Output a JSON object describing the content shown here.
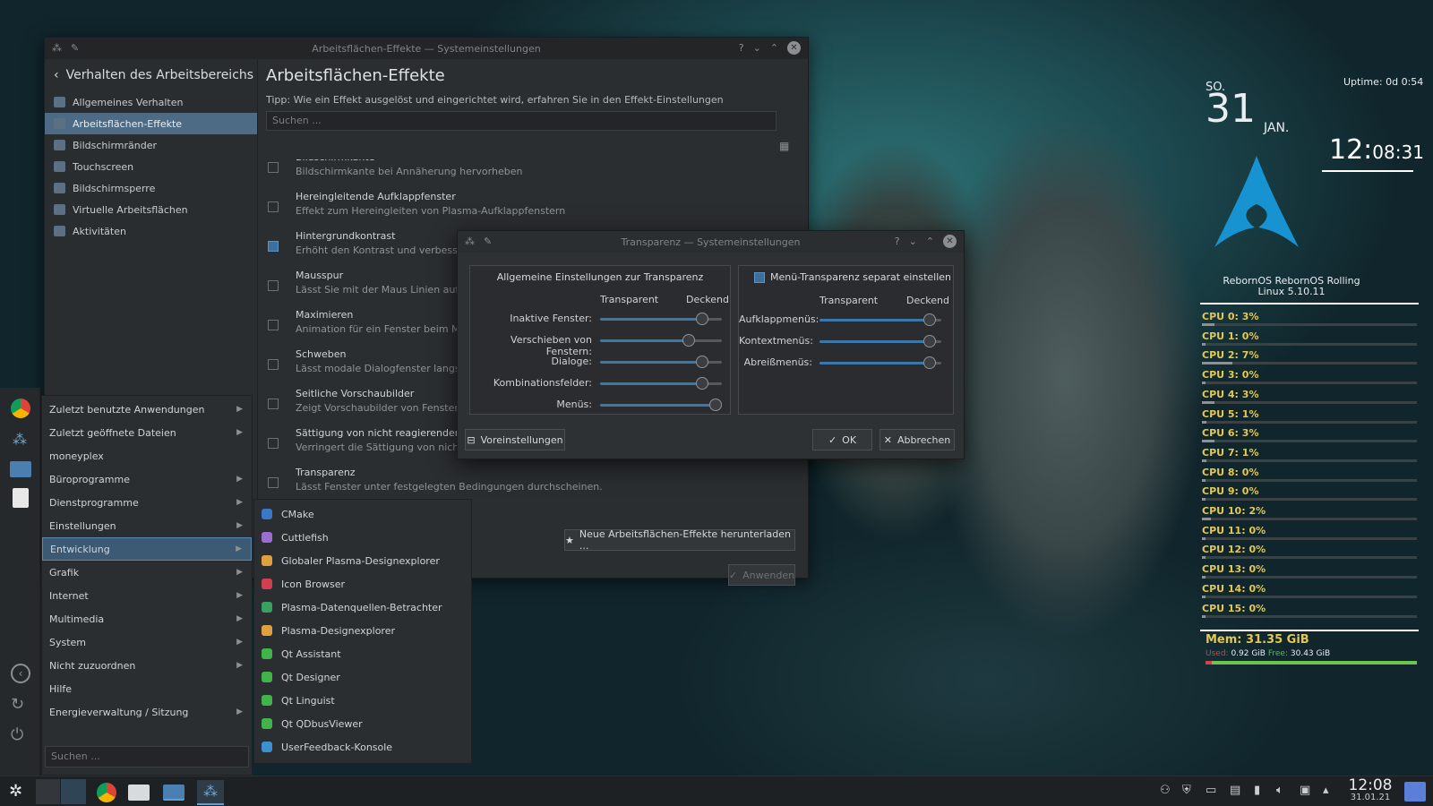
{
  "settings_window": {
    "title": "Arbeitsflächen-Effekte — Systemeinstellungen",
    "sidebar_header": "Verhalten des Arbeitsbereichs",
    "sidebar_items": [
      {
        "label": "Allgemeines Verhalten",
        "icon": "general-behavior-icon"
      },
      {
        "label": "Arbeitsflächen-Effekte",
        "icon": "star-icon",
        "selected": true
      },
      {
        "label": "Bildschirmränder",
        "icon": "screen-edges-icon"
      },
      {
        "label": "Touchscreen",
        "icon": "touchscreen-icon"
      },
      {
        "label": "Bildschirmsperre",
        "icon": "screen-lock-icon"
      },
      {
        "label": "Virtuelle Arbeitsflächen",
        "icon": "virtual-desktops-icon"
      },
      {
        "label": "Aktivitäten",
        "icon": "activities-icon"
      }
    ],
    "page_title": "Arbeitsflächen-Effekte",
    "tip": "Tipp: Wie ein Effekt ausgelöst und eingerichtet wird, erfahren Sie in den Effekt-Einstellungen",
    "search_placeholder": "Suchen ...",
    "effects": [
      {
        "title": "Bildschirmkante",
        "desc": "Bildschirmkante bei Annäherung hervorheben",
        "checked": false
      },
      {
        "title": "Hereingleitende Aufklappfenster",
        "desc": "Effekt zum Hereingleiten von Plasma-Aufklappfenstern",
        "checked": false
      },
      {
        "title": "Hintergrundkontrast",
        "desc": "Erhöht den Kontrast und verbessert",
        "checked": true
      },
      {
        "title": "Mausspur",
        "desc": "Lässt Sie mit der Maus Linien auf d",
        "checked": false
      },
      {
        "title": "Maximieren",
        "desc": "Animation für ein Fenster beim Max",
        "checked": false
      },
      {
        "title": "Schweben",
        "desc": "Lässt modale Dialogfenster langsam",
        "checked": false
      },
      {
        "title": "Seitliche Vorschaubilder",
        "desc": "Zeigt Vorschaubilder von Fenstern",
        "checked": false
      },
      {
        "title": "Sättigung von nicht reagierenden Anwendungen verringern",
        "desc": "Verringert die Sättigung von nicht r",
        "checked": false
      },
      {
        "title": "Transparenz",
        "desc": "Lässt Fenster unter festgelegten Bedingungen durchscheinen.",
        "checked": false
      }
    ],
    "download_button": "Neue Arbeitsflächen-Effekte herunterladen ...",
    "apply_button": "Anwenden"
  },
  "transparency_dialog": {
    "title": "Transparenz — Systemeinstellungen",
    "general_group_title": "Allgemeine Einstellungen zur Transparenz",
    "col_transparent": "Transparent",
    "col_opaque": "Deckend",
    "general_sliders": [
      {
        "label": "Inaktive Fenster:",
        "value": 0.88
      },
      {
        "label": "Verschieben von Fenstern:",
        "value": 0.75
      },
      {
        "label": "Dialoge:",
        "value": 0.88
      },
      {
        "label": "Kombinationsfelder:",
        "value": 0.88
      },
      {
        "label": "Menüs:",
        "value": 1.0
      }
    ],
    "menu_checkbox": "Menü-Transparenz separat einstellen",
    "menu_sliders": [
      {
        "label": "Aufklappmenüs:",
        "value": 0.95
      },
      {
        "label": "Kontextmenüs:",
        "value": 0.95
      },
      {
        "label": "Abreißmenüs:",
        "value": 0.95
      }
    ],
    "defaults_button": "Voreinstellungen",
    "ok_button": "OK",
    "cancel_button": "Abbrechen"
  },
  "app_menu": {
    "categories": [
      {
        "label": "Zuletzt benutzte Anwendungen",
        "sub": true
      },
      {
        "label": "Zuletzt geöffnete Dateien",
        "sub": true
      },
      {
        "label": "moneyplex",
        "sub": false
      },
      {
        "label": "Büroprogramme",
        "sub": true
      },
      {
        "label": "Dienstprogramme",
        "sub": true
      },
      {
        "label": "Einstellungen",
        "sub": true
      },
      {
        "label": "Entwicklung",
        "sub": true,
        "selected": true
      },
      {
        "label": "Grafik",
        "sub": true
      },
      {
        "label": "Internet",
        "sub": true
      },
      {
        "label": "Multimedia",
        "sub": true
      },
      {
        "label": "System",
        "sub": true
      },
      {
        "label": "Nicht zuzuordnen",
        "sub": true
      },
      {
        "label": "Hilfe",
        "sub": false
      },
      {
        "label": "Energieverwaltung / Sitzung",
        "sub": true
      }
    ],
    "search_placeholder": "Suchen ...",
    "dev_apps": [
      {
        "label": "CMake",
        "color": "#3b78c8"
      },
      {
        "label": "Cuttlefish",
        "color": "#9b6fd1"
      },
      {
        "label": "Globaler Plasma-Designexplorer",
        "color": "#e0a040"
      },
      {
        "label": "Icon Browser",
        "color": "#d04050"
      },
      {
        "label": "Plasma-Datenquellen-Betrachter",
        "color": "#3aa060"
      },
      {
        "label": "Plasma-Designexplorer",
        "color": "#e0a040"
      },
      {
        "label": "Qt Assistant",
        "color": "#41b34b"
      },
      {
        "label": "Qt Designer",
        "color": "#41b34b"
      },
      {
        "label": "Qt Linguist",
        "color": "#41b34b"
      },
      {
        "label": "Qt QDbusViewer",
        "color": "#41b34b"
      },
      {
        "label": "UserFeedback-Konsole",
        "color": "#3b90d0"
      }
    ]
  },
  "conky": {
    "day": "SO.",
    "date_num": "31",
    "month": "JAN.",
    "uptime": "Uptime: 0d 0:54",
    "time_hm": "12:",
    "time_s": "08:31",
    "distro": "RebornOS RebornOS Rolling",
    "kernel": "Linux 5.10.11",
    "cpus": [
      {
        "label": "CPU 0:",
        "pct": "3%",
        "value": 0.03
      },
      {
        "label": "CPU 1:",
        "pct": "0%",
        "value": 0.0
      },
      {
        "label": "CPU 2:",
        "pct": "7%",
        "value": 0.07
      },
      {
        "label": "CPU 3:",
        "pct": "0%",
        "value": 0.0
      },
      {
        "label": "CPU 4:",
        "pct": "3%",
        "value": 0.03
      },
      {
        "label": "CPU 5:",
        "pct": "1%",
        "value": 0.01
      },
      {
        "label": "CPU 6:",
        "pct": "3%",
        "value": 0.03
      },
      {
        "label": "CPU 7:",
        "pct": "1%",
        "value": 0.01
      },
      {
        "label": "CPU 8:",
        "pct": "0%",
        "value": 0.0
      },
      {
        "label": "CPU 9:",
        "pct": "0%",
        "value": 0.0
      },
      {
        "label": "CPU 10:",
        "pct": "2%",
        "value": 0.02
      },
      {
        "label": "CPU 11:",
        "pct": "0%",
        "value": 0.0
      },
      {
        "label": "CPU 12:",
        "pct": "0%",
        "value": 0.0
      },
      {
        "label": "CPU 13:",
        "pct": "0%",
        "value": 0.0
      },
      {
        "label": "CPU 14:",
        "pct": "0%",
        "value": 0.0
      },
      {
        "label": "CPU 15:",
        "pct": "0%",
        "value": 0.0
      }
    ],
    "mem_label": "Mem: 31.35 GiB",
    "used_label": "Used:",
    "used_value": "0.92 GiB",
    "free_label": "Free:",
    "free_value": "30.43 GiB",
    "mem_used_fraction": 0.03
  },
  "taskbar": {
    "clock_time": "12:08",
    "clock_date": "31.01.21"
  },
  "colors": {
    "accent": "#3c78a8",
    "cpu_label": "#e4c84f",
    "arch_logo": "#1793d1"
  }
}
